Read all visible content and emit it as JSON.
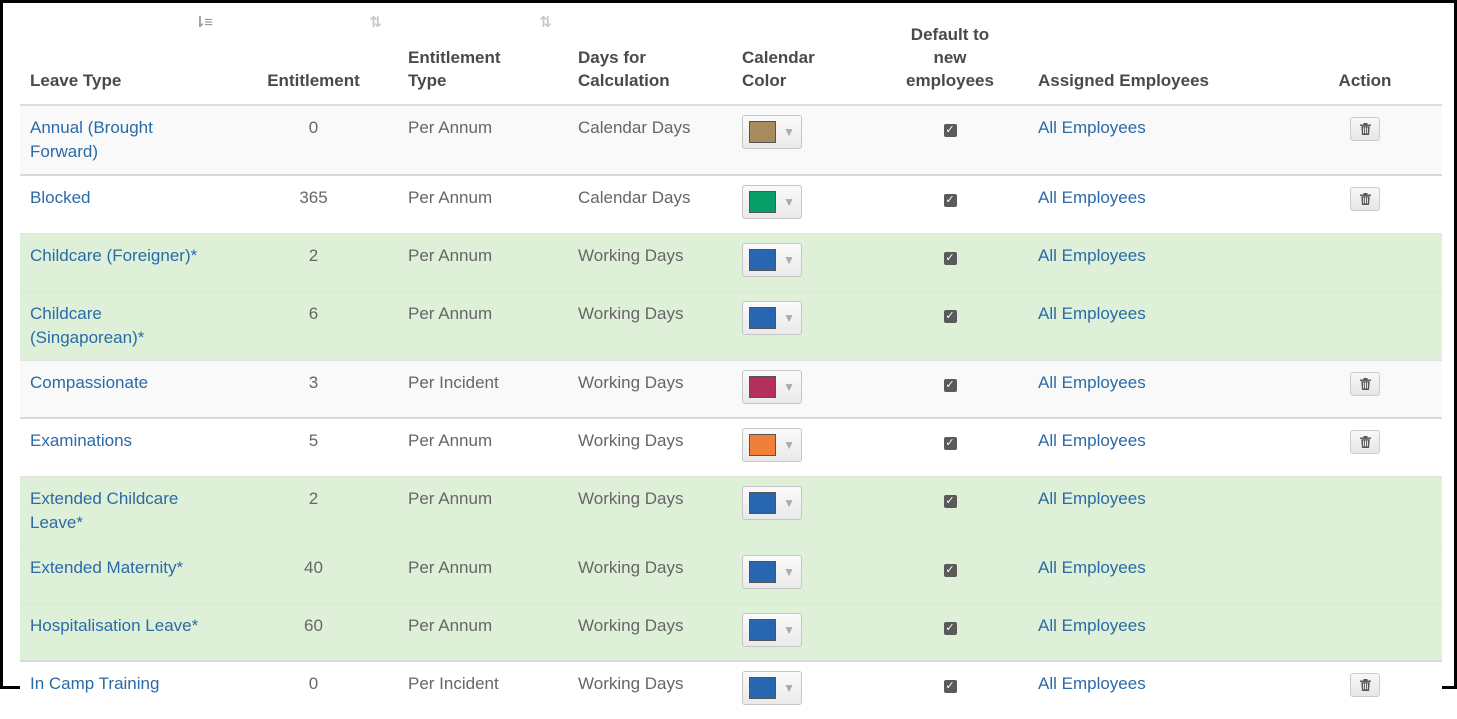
{
  "columns": {
    "leave_type": "Leave Type",
    "entitlement": "Entitlement",
    "entitlement_type": "Entitlement Type",
    "days_for_calc": "Days for Calculation",
    "calendar_color": "Calendar Color",
    "default_new": "Default to new employees",
    "assigned": "Assigned Employees",
    "action": "Action"
  },
  "sort_icons": {
    "leave_type": "sort-amount-down-icon",
    "entitlement": "sort-icon",
    "entitlement_type": "sort-icon"
  },
  "rows": [
    {
      "name": "Annual (Brought Forward)",
      "entitlement": "0",
      "type": "Per Annum",
      "days": "Calendar Days",
      "color": "#a88c5e",
      "default": true,
      "assigned": "All Employees",
      "deletable": true,
      "style": "odd"
    },
    {
      "name": "Blocked",
      "entitlement": "365",
      "type": "Per Annum",
      "days": "Calendar Days",
      "color": "#079e6a",
      "default": true,
      "assigned": "All Employees",
      "deletable": true,
      "style": "even"
    },
    {
      "name": "Childcare (Foreigner)*",
      "entitlement": "2",
      "type": "Per Annum",
      "days": "Working Days",
      "color": "#2867b0",
      "default": true,
      "assigned": "All Employees",
      "deletable": false,
      "style": "green"
    },
    {
      "name": "Childcare (Singaporean)*",
      "entitlement": "6",
      "type": "Per Annum",
      "days": "Working Days",
      "color": "#2867b0",
      "default": true,
      "assigned": "All Employees",
      "deletable": false,
      "style": "green"
    },
    {
      "name": "Compassionate",
      "entitlement": "3",
      "type": "Per Incident",
      "days": "Working Days",
      "color": "#b3305a",
      "default": true,
      "assigned": "All Employees",
      "deletable": true,
      "style": "odd"
    },
    {
      "name": "Examinations",
      "entitlement": "5",
      "type": "Per Annum",
      "days": "Working Days",
      "color": "#f07f3a",
      "default": true,
      "assigned": "All Employees",
      "deletable": true,
      "style": "even"
    },
    {
      "name": "Extended Childcare Leave*",
      "entitlement": "2",
      "type": "Per Annum",
      "days": "Working Days",
      "color": "#2867b0",
      "default": true,
      "assigned": "All Employees",
      "deletable": false,
      "style": "green"
    },
    {
      "name": "Extended Maternity*",
      "entitlement": "40",
      "type": "Per Annum",
      "days": "Working Days",
      "color": "#2867b0",
      "default": true,
      "assigned": "All Employees",
      "deletable": false,
      "style": "green"
    },
    {
      "name": "Hospitalisation Leave*",
      "entitlement": "60",
      "type": "Per Annum",
      "days": "Working Days",
      "color": "#2867b0",
      "default": true,
      "assigned": "All Employees",
      "deletable": false,
      "style": "green"
    },
    {
      "name": "In Camp Training",
      "entitlement": "0",
      "type": "Per Incident",
      "days": "Working Days",
      "color": "#2867b0",
      "default": true,
      "assigned": "All Employees",
      "deletable": true,
      "style": "even"
    }
  ]
}
